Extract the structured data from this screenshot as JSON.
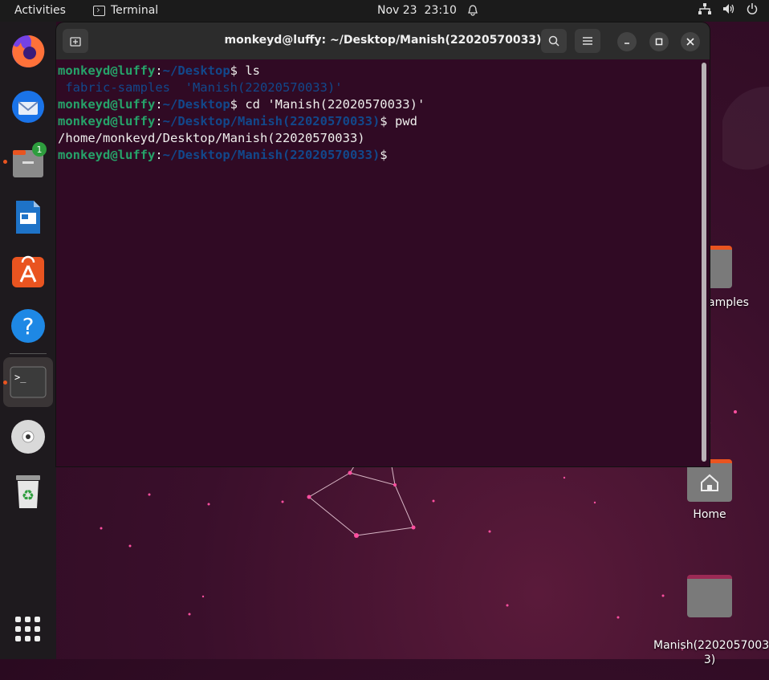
{
  "topbar": {
    "activities": "Activities",
    "app_name": "Terminal",
    "date": "Nov 23",
    "time": "23:10"
  },
  "dock": {
    "files_badge": "1",
    "items": [
      "firefox-icon",
      "thunderbird-icon",
      "files-icon",
      "libreoffice-writer-icon",
      "app-center-icon",
      "help-icon",
      "terminal-icon",
      "dvd-icon",
      "trash-icon",
      "show-apps-icon"
    ]
  },
  "terminal": {
    "title": "monkeyd@luffy: ~/Desktop/Manish(22020570033)",
    "lines": [
      {
        "user": "monkeyd@luffy",
        "sep": ":",
        "path": "~/Desktop",
        "cmd": "$ ls"
      },
      {
        "output_blue": " fabric-samples  'Manish(22020570033)'"
      },
      {
        "user": "monkeyd@luffy",
        "sep": ":",
        "path": "~/Desktop",
        "cmd": "$ cd 'Manish(22020570033)'"
      },
      {
        "user": "monkeyd@luffy",
        "sep": ":",
        "path": "~/Desktop/Manish(22020570033)",
        "cmd": "$ pwd"
      },
      {
        "output": "/home/monkeyd/Desktop/Manish(22020570033)"
      },
      {
        "user": "monkeyd@luffy",
        "sep": ":",
        "path": "~/Desktop/Manish(22020570033)",
        "cmd": "$"
      }
    ]
  },
  "desktop": {
    "icons": [
      {
        "label": "amples"
      },
      {
        "label": "Home"
      },
      {
        "label": "Manish(2202057003\n3)"
      }
    ]
  },
  "colors": {
    "accent": "#e95420",
    "term_bg": "#300a24",
    "prompt_user": "#26a269",
    "prompt_path": "#12488b"
  }
}
